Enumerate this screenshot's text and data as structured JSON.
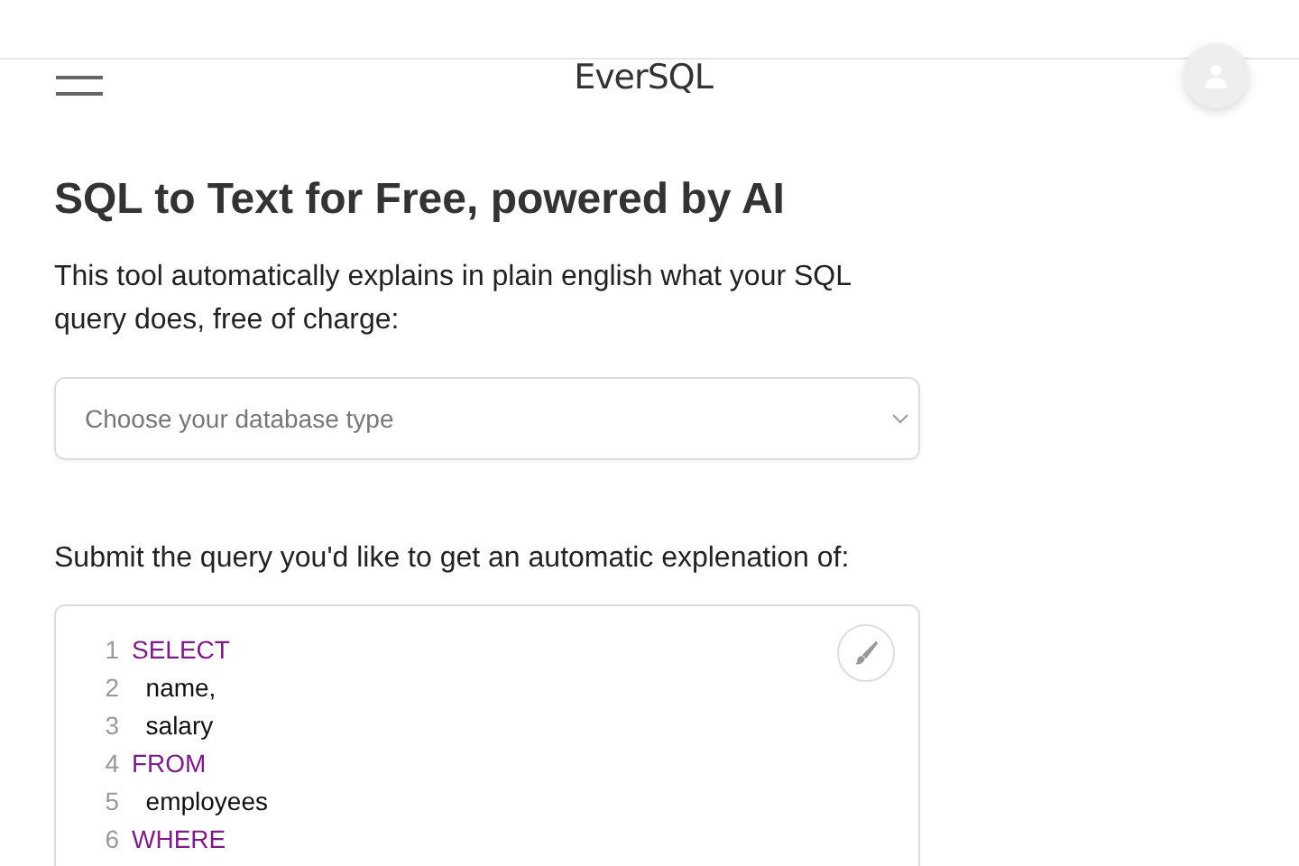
{
  "header": {
    "logo": "EverSQL"
  },
  "title": "SQL to Text for Free, powered by AI",
  "intro": "This tool automatically explains in plain english what your SQL query does, free of charge:",
  "database_select": {
    "placeholder": "Choose your database type"
  },
  "query_label": "Submit the query you'd like to get an automatic explenation of:",
  "editor": {
    "lines": [
      {
        "number": "1",
        "text": "SELECT",
        "kind": "keyword"
      },
      {
        "number": "2",
        "text": "  name,",
        "kind": "plain"
      },
      {
        "number": "3",
        "text": "  salary",
        "kind": "plain"
      },
      {
        "number": "4",
        "text": "FROM",
        "kind": "keyword"
      },
      {
        "number": "5",
        "text": "  employees",
        "kind": "plain"
      },
      {
        "number": "6",
        "text": "WHERE",
        "kind": "keyword"
      }
    ]
  }
}
